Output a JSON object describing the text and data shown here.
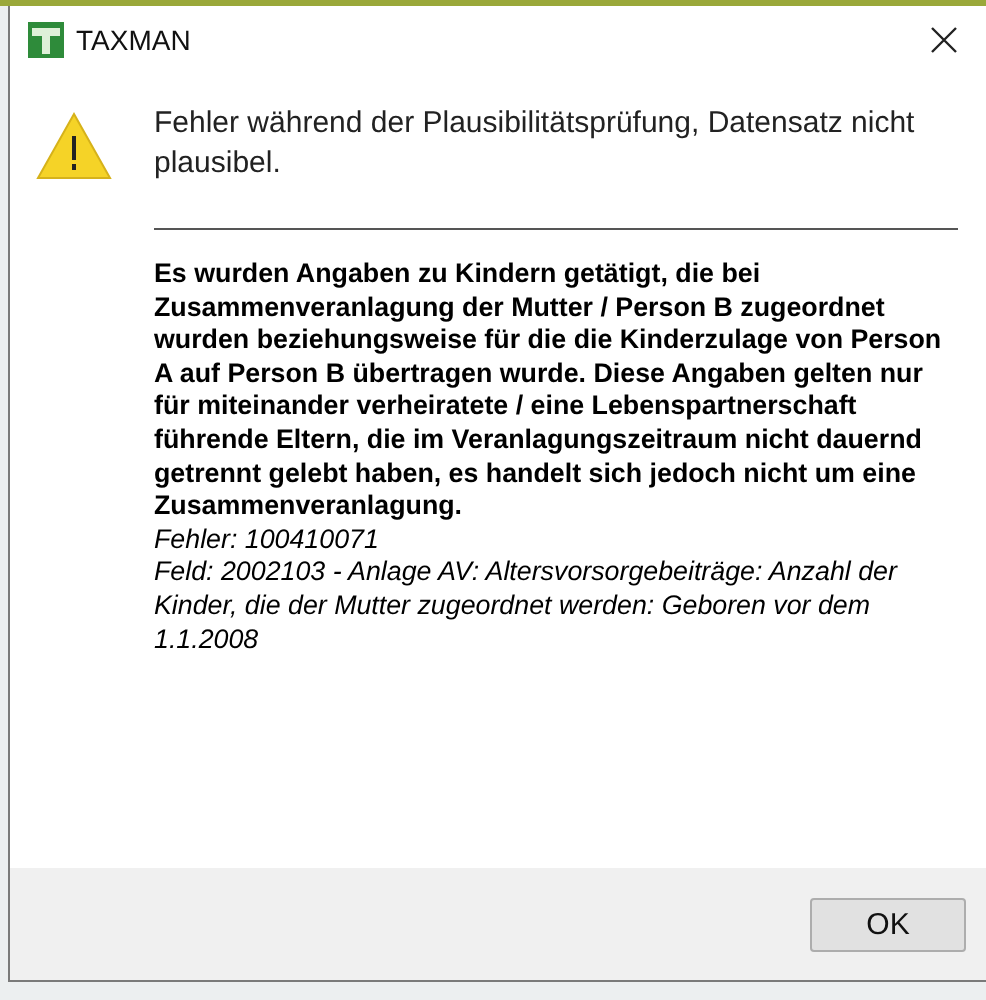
{
  "window": {
    "title": "TAXMAN"
  },
  "message": "Fehler während der Plausibilitätsprüfung, Datensatz nicht plausibel.",
  "details": "Es wurden Angaben zu Kindern getätigt, die bei Zusammenveranlagung der Mutter / Person B zugeordnet wurden beziehungsweise für die die Kinderzulage von Person A auf Person B übertragen wurde. Diese Angaben gelten nur für miteinander verheiratete / eine Lebenspartnerschaft führende Eltern, die im Veranlagungszeitraum nicht dauernd getrennt gelebt haben, es handelt sich jedoch nicht um eine Zusammenveranlagung.",
  "error_lines": [
    "Fehler: 100410071",
    "Feld: 2002103 - Anlage AV: Altersvorsorgebeiträge: Anzahl der Kinder, die der Mutter zugeordnet werden: Geboren vor dem 1.1.2008"
  ],
  "buttons": [
    "OK"
  ]
}
